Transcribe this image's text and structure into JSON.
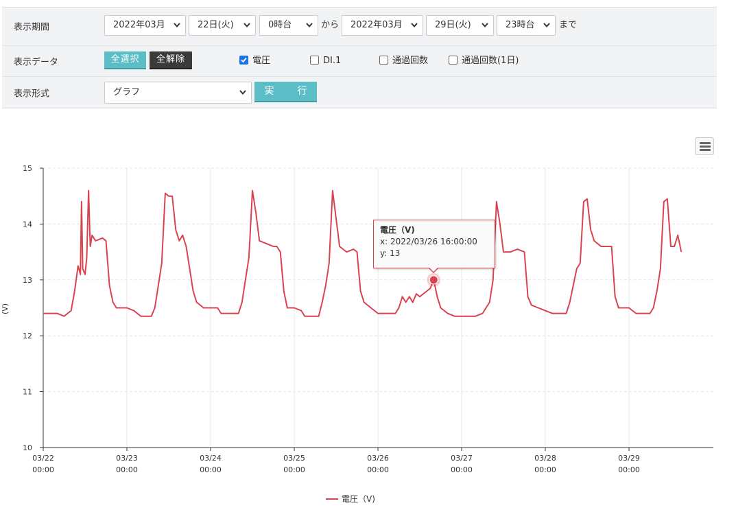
{
  "filter": {
    "period_label": "表示期間",
    "start_month": "2022年03月",
    "start_day": "22日(火)",
    "start_hour": "0時台",
    "from_text": "から",
    "end_month": "2022年03月",
    "end_day": "29日(火)",
    "end_hour": "23時台",
    "until_text": "まで",
    "data_label": "表示データ",
    "select_all": "全選択",
    "clear_all": "全解除",
    "checkboxes": [
      {
        "label": "電圧",
        "checked": true
      },
      {
        "label": "DI.1",
        "checked": false
      },
      {
        "label": "通過回数",
        "checked": false
      },
      {
        "label": "通過回数(1日)",
        "checked": false
      }
    ],
    "format_label": "表示形式",
    "format_value": "グラフ",
    "execute": "実　行"
  },
  "colors": {
    "series": "#d9434f",
    "accent": "#5bbec6",
    "dark_button": "#3a3a3a"
  },
  "tooltip": {
    "title": "電圧（V)",
    "x_text": "x: 2022/03/26 16:00:00",
    "y_text": "y: 13"
  },
  "chart_data": {
    "type": "line",
    "ylabel": "(V)",
    "ylim": [
      10,
      15
    ],
    "yticks": [
      10,
      11,
      12,
      13,
      14,
      15
    ],
    "xlim": [
      "2022-03-22 00:00",
      "2022-03-30 00:00"
    ],
    "xticks": [
      {
        "date": "03/22",
        "time": "00:00"
      },
      {
        "date": "03/23",
        "time": "00:00"
      },
      {
        "date": "03/24",
        "time": "00:00"
      },
      {
        "date": "03/25",
        "time": "00:00"
      },
      {
        "date": "03/26",
        "time": "00:00"
      },
      {
        "date": "03/27",
        "time": "00:00"
      },
      {
        "date": "03/28",
        "time": "00:00"
      },
      {
        "date": "03/29",
        "time": "00:00"
      }
    ],
    "grid": true,
    "legend": "bottom-center",
    "highlight": {
      "x": "2022-03-26 16:00",
      "y": 13
    },
    "series": [
      {
        "name": "電圧（V)",
        "points": [
          [
            "2022-03-22 00:00",
            12.4
          ],
          [
            "2022-03-22 04:00",
            12.4
          ],
          [
            "2022-03-22 06:00",
            12.35
          ],
          [
            "2022-03-22 07:00",
            12.4
          ],
          [
            "2022-03-22 08:00",
            12.45
          ],
          [
            "2022-03-22 09:00",
            12.8
          ],
          [
            "2022-03-22 10:00",
            13.25
          ],
          [
            "2022-03-22 10:40",
            13.1
          ],
          [
            "2022-03-22 11:00",
            14.4
          ],
          [
            "2022-03-22 11:20",
            13.2
          ],
          [
            "2022-03-22 12:00",
            13.1
          ],
          [
            "2022-03-22 12:30",
            13.4
          ],
          [
            "2022-03-22 13:00",
            14.6
          ],
          [
            "2022-03-22 13:30",
            13.6
          ],
          [
            "2022-03-22 14:00",
            13.8
          ],
          [
            "2022-03-22 15:00",
            13.7
          ],
          [
            "2022-03-22 17:00",
            13.75
          ],
          [
            "2022-03-22 18:00",
            13.7
          ],
          [
            "2022-03-22 19:00",
            12.9
          ],
          [
            "2022-03-22 20:00",
            12.6
          ],
          [
            "2022-03-22 21:00",
            12.5
          ],
          [
            "2022-03-23 00:00",
            12.5
          ],
          [
            "2022-03-23 02:00",
            12.45
          ],
          [
            "2022-03-23 04:00",
            12.35
          ],
          [
            "2022-03-23 07:00",
            12.35
          ],
          [
            "2022-03-23 08:00",
            12.5
          ],
          [
            "2022-03-23 09:00",
            12.9
          ],
          [
            "2022-03-23 10:00",
            13.3
          ],
          [
            "2022-03-23 11:00",
            14.55
          ],
          [
            "2022-03-23 12:00",
            14.5
          ],
          [
            "2022-03-23 13:00",
            14.5
          ],
          [
            "2022-03-23 14:00",
            13.9
          ],
          [
            "2022-03-23 15:00",
            13.7
          ],
          [
            "2022-03-23 16:00",
            13.8
          ],
          [
            "2022-03-23 17:00",
            13.6
          ],
          [
            "2022-03-23 18:00",
            13.2
          ],
          [
            "2022-03-23 19:00",
            12.8
          ],
          [
            "2022-03-23 20:00",
            12.6
          ],
          [
            "2022-03-23 22:00",
            12.5
          ],
          [
            "2022-03-24 02:00",
            12.5
          ],
          [
            "2022-03-24 03:00",
            12.4
          ],
          [
            "2022-03-24 08:00",
            12.4
          ],
          [
            "2022-03-24 09:00",
            12.6
          ],
          [
            "2022-03-24 10:00",
            13.0
          ],
          [
            "2022-03-24 11:00",
            13.4
          ],
          [
            "2022-03-24 12:00",
            14.6
          ],
          [
            "2022-03-24 13:00",
            14.2
          ],
          [
            "2022-03-24 14:00",
            13.7
          ],
          [
            "2022-03-24 16:00",
            13.65
          ],
          [
            "2022-03-24 18:00",
            13.6
          ],
          [
            "2022-03-24 19:00",
            13.6
          ],
          [
            "2022-03-24 20:00",
            13.5
          ],
          [
            "2022-03-24 21:00",
            12.8
          ],
          [
            "2022-03-24 22:00",
            12.5
          ],
          [
            "2022-03-25 00:00",
            12.5
          ],
          [
            "2022-03-25 02:00",
            12.45
          ],
          [
            "2022-03-25 03:00",
            12.35
          ],
          [
            "2022-03-25 07:00",
            12.35
          ],
          [
            "2022-03-25 08:00",
            12.6
          ],
          [
            "2022-03-25 09:00",
            12.9
          ],
          [
            "2022-03-25 10:00",
            13.3
          ],
          [
            "2022-03-25 11:00",
            14.6
          ],
          [
            "2022-03-25 12:00",
            14.1
          ],
          [
            "2022-03-25 13:00",
            13.6
          ],
          [
            "2022-03-25 15:00",
            13.5
          ],
          [
            "2022-03-25 17:00",
            13.55
          ],
          [
            "2022-03-25 18:00",
            13.5
          ],
          [
            "2022-03-25 19:00",
            12.8
          ],
          [
            "2022-03-25 20:00",
            12.6
          ],
          [
            "2022-03-25 22:00",
            12.5
          ],
          [
            "2022-03-26 00:00",
            12.4
          ],
          [
            "2022-03-26 05:00",
            12.4
          ],
          [
            "2022-03-26 06:00",
            12.5
          ],
          [
            "2022-03-26 07:00",
            12.7
          ],
          [
            "2022-03-26 08:00",
            12.6
          ],
          [
            "2022-03-26 09:00",
            12.7
          ],
          [
            "2022-03-26 10:00",
            12.6
          ],
          [
            "2022-03-26 11:00",
            12.75
          ],
          [
            "2022-03-26 12:00",
            12.7
          ],
          [
            "2022-03-26 14:00",
            12.8
          ],
          [
            "2022-03-26 15:00",
            12.85
          ],
          [
            "2022-03-26 16:00",
            13.0
          ],
          [
            "2022-03-26 17:00",
            12.7
          ],
          [
            "2022-03-26 18:00",
            12.5
          ],
          [
            "2022-03-26 20:00",
            12.4
          ],
          [
            "2022-03-26 22:00",
            12.35
          ],
          [
            "2022-03-27 04:00",
            12.35
          ],
          [
            "2022-03-27 06:00",
            12.4
          ],
          [
            "2022-03-27 08:00",
            12.6
          ],
          [
            "2022-03-27 09:00",
            13.0
          ],
          [
            "2022-03-27 10:00",
            14.4
          ],
          [
            "2022-03-27 11:00",
            14.0
          ],
          [
            "2022-03-27 12:00",
            13.5
          ],
          [
            "2022-03-27 14:00",
            13.5
          ],
          [
            "2022-03-27 16:00",
            13.55
          ],
          [
            "2022-03-27 18:00",
            13.5
          ],
          [
            "2022-03-27 19:00",
            12.7
          ],
          [
            "2022-03-27 20:00",
            12.55
          ],
          [
            "2022-03-27 22:00",
            12.5
          ],
          [
            "2022-03-28 00:00",
            12.45
          ],
          [
            "2022-03-28 02:00",
            12.4
          ],
          [
            "2022-03-28 06:00",
            12.4
          ],
          [
            "2022-03-28 07:00",
            12.6
          ],
          [
            "2022-03-28 08:00",
            12.9
          ],
          [
            "2022-03-28 09:00",
            13.2
          ],
          [
            "2022-03-28 10:00",
            13.3
          ],
          [
            "2022-03-28 11:00",
            14.4
          ],
          [
            "2022-03-28 12:00",
            14.45
          ],
          [
            "2022-03-28 13:00",
            13.9
          ],
          [
            "2022-03-28 14:00",
            13.7
          ],
          [
            "2022-03-28 16:00",
            13.6
          ],
          [
            "2022-03-28 19:00",
            13.6
          ],
          [
            "2022-03-28 20:00",
            12.7
          ],
          [
            "2022-03-28 21:00",
            12.5
          ],
          [
            "2022-03-29 00:00",
            12.5
          ],
          [
            "2022-03-29 02:00",
            12.4
          ],
          [
            "2022-03-29 06:00",
            12.4
          ],
          [
            "2022-03-29 07:00",
            12.5
          ],
          [
            "2022-03-29 08:00",
            12.8
          ],
          [
            "2022-03-29 09:00",
            13.2
          ],
          [
            "2022-03-29 10:00",
            14.4
          ],
          [
            "2022-03-29 11:00",
            14.45
          ],
          [
            "2022-03-29 12:00",
            13.6
          ],
          [
            "2022-03-29 13:00",
            13.6
          ],
          [
            "2022-03-29 14:00",
            13.8
          ],
          [
            "2022-03-29 15:00",
            13.5
          ]
        ]
      }
    ]
  }
}
